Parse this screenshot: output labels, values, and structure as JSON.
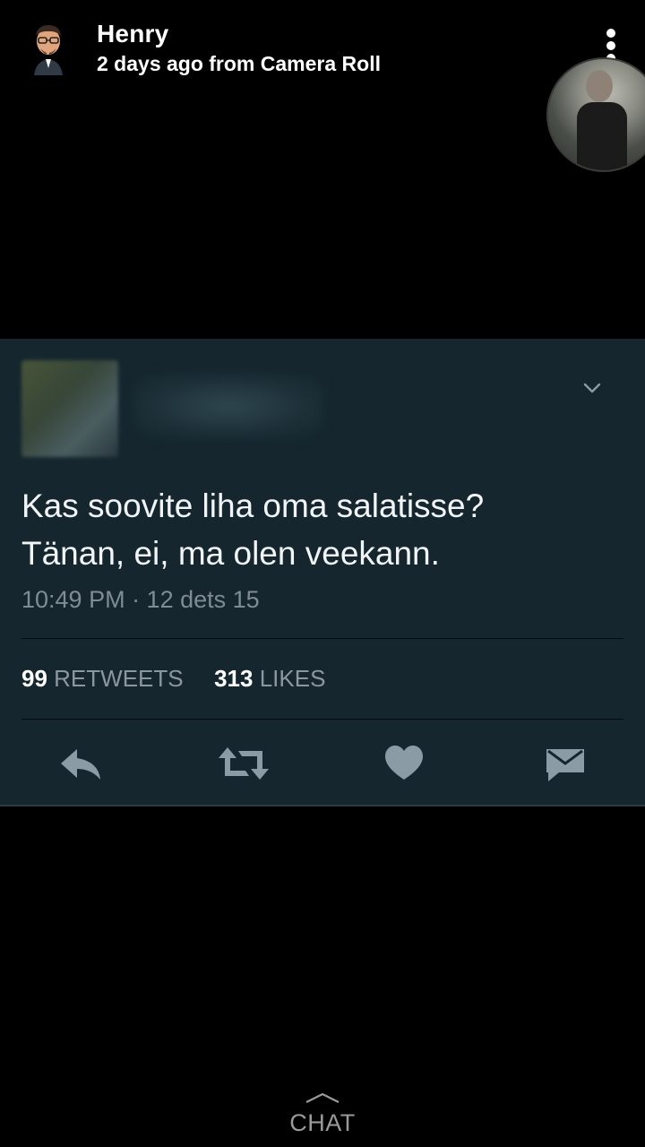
{
  "header": {
    "name": "Henry",
    "subtitle": "2 days ago from Camera Roll",
    "avatar_icon": "bitmoji-avatar",
    "menu_icon": "more-vertical-icon"
  },
  "tweet": {
    "text_line1": "Kas soovite liha oma salatisse?",
    "text_line2": "Tänan, ei, ma olen veekann.",
    "timestamp": "10:49 PM · 12 dets 15",
    "retweets_count": "99",
    "retweets_label": "RETWEETS",
    "likes_count": "313",
    "likes_label": "LIKES",
    "colors": {
      "card_bg": "#15262e",
      "icon": "#8a9ba5"
    }
  },
  "footer": {
    "chat_label": "CHAT"
  }
}
